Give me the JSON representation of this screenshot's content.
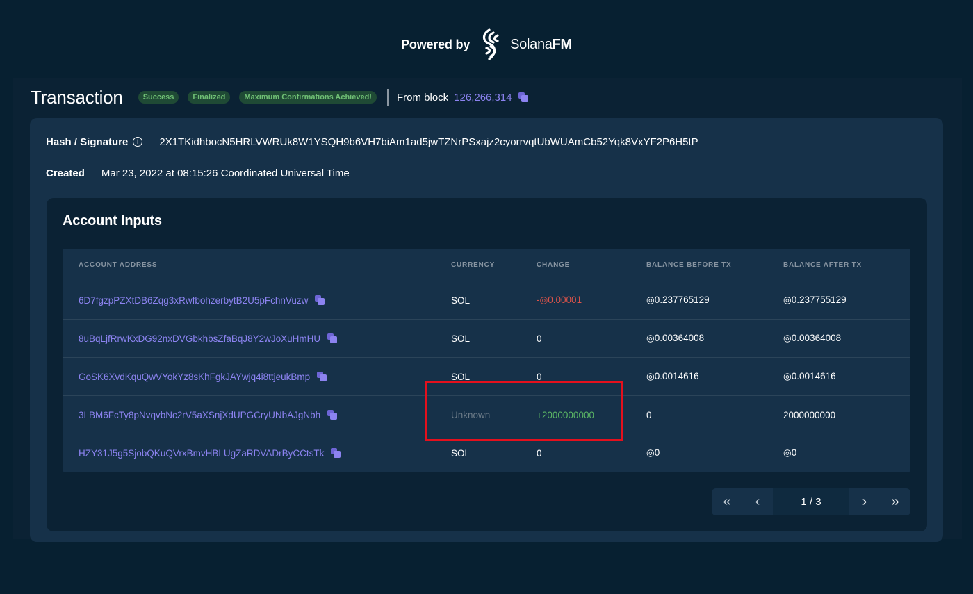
{
  "header": {
    "powered_by": "Powered by",
    "brand_light": "Solana",
    "brand_bold": "FM"
  },
  "transaction": {
    "title": "Transaction",
    "badges": [
      "Success",
      "Finalized",
      "Maximum Confirmations Achieved!"
    ],
    "from_block_label": "From block",
    "block_number": "126,266,314"
  },
  "details": {
    "hash_label": "Hash / Signature",
    "hash_value": "2X1TKidhbocN5HRLVWRUk8W1YSQH9b6VH7biAm1ad5jwTZNrPSxajz2cyorrvqtUbWUAmCb52Yqk8VxYF2P6H5tP",
    "created_label": "Created",
    "created_value": "Mar 23, 2022 at 08:15:26 Coordinated Universal Time"
  },
  "account_inputs": {
    "title": "Account Inputs",
    "columns": [
      "ACCOUNT ADDRESS",
      "CURRENCY",
      "CHANGE",
      "BALANCE BEFORE TX",
      "BALANCE AFTER TX"
    ],
    "rows": [
      {
        "address": "6D7fgzpPZXtDB6Zqg3xRwfbohzerbytB2U5pFchnVuzw",
        "currency": "SOL",
        "change": "-◎0.00001",
        "before": "◎0.237765129",
        "after": "◎0.237755129"
      },
      {
        "address": "8uBqLjfRrwKxDG92nxDVGbkhbsZfaBqJ8Y2wJoXuHmHU",
        "currency": "SOL",
        "change": "0",
        "before": "◎0.00364008",
        "after": "◎0.00364008"
      },
      {
        "address": "GoSK6XvdKquQwVYokYz8sKhFgkJAYwjq4i8ttjeukBmp",
        "currency": "SOL",
        "change": "0",
        "before": "◎0.0014616",
        "after": "◎0.0014616"
      },
      {
        "address": "3LBM6FcTy8pNvqvbNc2rV5aXSnjXdUPGCryUNbAJgNbh",
        "currency": "Unknown",
        "change": "+2000000000",
        "before": "0",
        "after": "2000000000"
      },
      {
        "address": "HZY31J5g5SjobQKuQVrxBmvHBLUgZaRDVADrByCCtsTk",
        "currency": "SOL",
        "change": "0",
        "before": "◎0",
        "after": "◎0"
      }
    ]
  },
  "pagination": {
    "first": "«",
    "prev": "‹",
    "indicator": "1 / 3",
    "next": "›",
    "last": "»"
  },
  "colors": {
    "background": "#072031",
    "card": "#163149",
    "link": "#8c83f0",
    "negative": "#d9534a",
    "positive": "#5cb865",
    "highlight": "#e4101d"
  }
}
